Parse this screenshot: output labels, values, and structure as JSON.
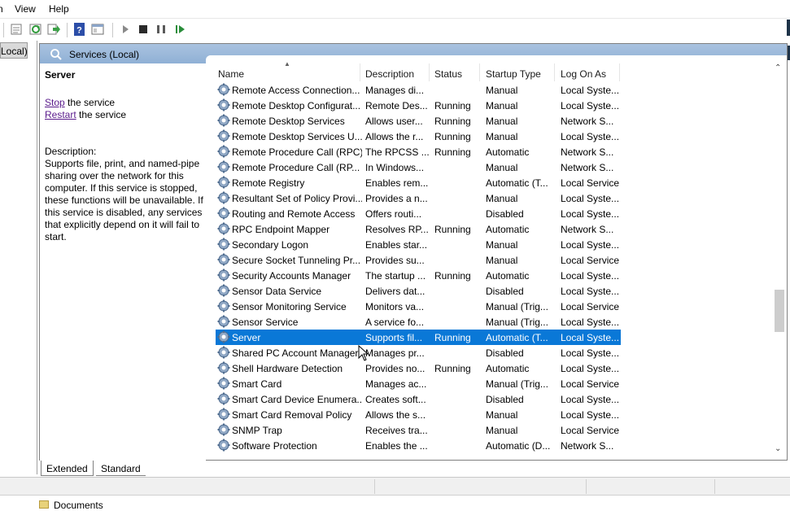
{
  "menubar": {
    "edge_label": "n",
    "view": "View",
    "help": "Help"
  },
  "tree": {
    "selected_label": "Local)"
  },
  "header": {
    "title": "Services (Local)"
  },
  "details": {
    "service_name": "Server",
    "stop_link": "Stop",
    "stop_suffix": " the service",
    "restart_link": "Restart",
    "restart_suffix": " the service",
    "description_label": "Description:",
    "description_text": "Supports file, print, and named-pipe sharing over the network for this computer. If this service is stopped, these functions will be unavailable. If this service is disabled, any services that explicitly depend on it will fail to start."
  },
  "columns": {
    "name": "Name",
    "description": "Description",
    "status": "Status",
    "startup_type": "Startup Type",
    "log_on_as": "Log On As"
  },
  "rows": [
    {
      "name": "Remote Access Connection...",
      "desc": "Manages di...",
      "status": "",
      "startup": "Manual",
      "logon": "Local Syste..."
    },
    {
      "name": "Remote Desktop Configurat...",
      "desc": "Remote Des...",
      "status": "Running",
      "startup": "Manual",
      "logon": "Local Syste..."
    },
    {
      "name": "Remote Desktop Services",
      "desc": "Allows user...",
      "status": "Running",
      "startup": "Manual",
      "logon": "Network S..."
    },
    {
      "name": "Remote Desktop Services U...",
      "desc": "Allows the r...",
      "status": "Running",
      "startup": "Manual",
      "logon": "Local Syste..."
    },
    {
      "name": "Remote Procedure Call (RPC)",
      "desc": "The RPCSS ...",
      "status": "Running",
      "startup": "Automatic",
      "logon": "Network S..."
    },
    {
      "name": "Remote Procedure Call (RP...",
      "desc": "In Windows...",
      "status": "",
      "startup": "Manual",
      "logon": "Network S..."
    },
    {
      "name": "Remote Registry",
      "desc": "Enables rem...",
      "status": "",
      "startup": "Automatic (T...",
      "logon": "Local Service"
    },
    {
      "name": "Resultant Set of Policy Provi...",
      "desc": "Provides a n...",
      "status": "",
      "startup": "Manual",
      "logon": "Local Syste..."
    },
    {
      "name": "Routing and Remote Access",
      "desc": "Offers routi...",
      "status": "",
      "startup": "Disabled",
      "logon": "Local Syste..."
    },
    {
      "name": "RPC Endpoint Mapper",
      "desc": "Resolves RP...",
      "status": "Running",
      "startup": "Automatic",
      "logon": "Network S..."
    },
    {
      "name": "Secondary Logon",
      "desc": "Enables star...",
      "status": "",
      "startup": "Manual",
      "logon": "Local Syste..."
    },
    {
      "name": "Secure Socket Tunneling Pr...",
      "desc": "Provides su...",
      "status": "",
      "startup": "Manual",
      "logon": "Local Service"
    },
    {
      "name": "Security Accounts Manager",
      "desc": "The startup ...",
      "status": "Running",
      "startup": "Automatic",
      "logon": "Local Syste..."
    },
    {
      "name": "Sensor Data Service",
      "desc": "Delivers dat...",
      "status": "",
      "startup": "Disabled",
      "logon": "Local Syste..."
    },
    {
      "name": "Sensor Monitoring Service",
      "desc": "Monitors va...",
      "status": "",
      "startup": "Manual (Trig...",
      "logon": "Local Service"
    },
    {
      "name": "Sensor Service",
      "desc": "A service fo...",
      "status": "",
      "startup": "Manual (Trig...",
      "logon": "Local Syste..."
    },
    {
      "name": "Server",
      "desc": "Supports fil...",
      "status": "Running",
      "startup": "Automatic (T...",
      "logon": "Local Syste..."
    },
    {
      "name": "Shared PC Account Manager",
      "desc": "Manages pr...",
      "status": "",
      "startup": "Disabled",
      "logon": "Local Syste..."
    },
    {
      "name": "Shell Hardware Detection",
      "desc": "Provides no...",
      "status": "Running",
      "startup": "Automatic",
      "logon": "Local Syste..."
    },
    {
      "name": "Smart Card",
      "desc": "Manages ac...",
      "status": "",
      "startup": "Manual (Trig...",
      "logon": "Local Service"
    },
    {
      "name": "Smart Card Device Enumera...",
      "desc": "Creates soft...",
      "status": "",
      "startup": "Disabled",
      "logon": "Local Syste..."
    },
    {
      "name": "Smart Card Removal Policy",
      "desc": "Allows the s...",
      "status": "",
      "startup": "Manual",
      "logon": "Local Syste..."
    },
    {
      "name": "SNMP Trap",
      "desc": "Receives tra...",
      "status": "",
      "startup": "Manual",
      "logon": "Local Service"
    },
    {
      "name": "Software Protection",
      "desc": "Enables the ...",
      "status": "",
      "startup": "Automatic (D...",
      "logon": "Network S..."
    }
  ],
  "selected_row_index": 16,
  "tabs": {
    "extended": "Extended",
    "standard": "Standard"
  },
  "taskbar": {
    "documents": "Documents"
  },
  "colors": {
    "selection": "#0a78d7",
    "header_band": "#9bb9dc",
    "link": "#5a1b8c"
  },
  "icons": [
    "gear-icon",
    "services-icon",
    "play-icon",
    "stop-icon",
    "pause-icon",
    "restart-icon",
    "help-icon",
    "properties-icon",
    "refresh-icon",
    "export-icon"
  ]
}
